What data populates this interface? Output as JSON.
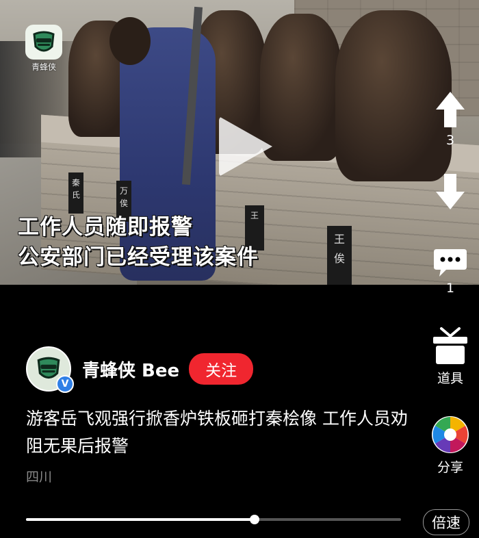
{
  "video": {
    "logo_text": "青蜂侠",
    "caption_line1": "工作人员随即报警",
    "caption_line2": "公安部门已经受理该案件",
    "plaques": [
      "秦 氏",
      "万 俟",
      "王",
      "王 俟"
    ],
    "progress": 0.61
  },
  "side": {
    "up_icon": "arrow-up-icon",
    "count": "3",
    "down_icon": "arrow-down-icon",
    "comment_icon": "comment-icon",
    "comment_count": "1",
    "prop_icon": "gift-icon",
    "prop_label": "道具",
    "share_icon": "share-aperture-icon",
    "share_label": "分享"
  },
  "author": {
    "name": "青蜂侠 Bee",
    "follow_label": "关注",
    "verified_mark": "V"
  },
  "description": "游客岳飞观强行掀香炉铁板砸打秦桧像 工作人员劝阻无果后报警",
  "location": "四川",
  "player": {
    "speed_label": "倍速"
  },
  "colors": {
    "follow": "#f0262f",
    "verified": "#2f7fe6",
    "background": "#000000"
  }
}
